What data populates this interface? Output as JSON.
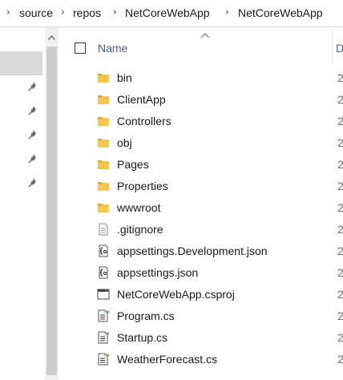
{
  "breadcrumb": {
    "parts": [
      "source",
      "repos",
      "NetCoreWebApp",
      "NetCoreWebApp"
    ],
    "separator": "›"
  },
  "header": {
    "name_label": "Name",
    "next_column_fragment": "D"
  },
  "files": [
    {
      "name": "bin",
      "type": "folder",
      "date_fragment": "2"
    },
    {
      "name": "ClientApp",
      "type": "folder",
      "date_fragment": "2"
    },
    {
      "name": "Controllers",
      "type": "folder",
      "date_fragment": "2"
    },
    {
      "name": "obj",
      "type": "folder",
      "date_fragment": "2"
    },
    {
      "name": "Pages",
      "type": "folder",
      "date_fragment": "2"
    },
    {
      "name": "Properties",
      "type": "folder",
      "date_fragment": "2"
    },
    {
      "name": "wwwroot",
      "type": "folder",
      "date_fragment": "2"
    },
    {
      "name": ".gitignore",
      "type": "text-file",
      "date_fragment": "2"
    },
    {
      "name": "appsettings.Development.json",
      "type": "json-file",
      "date_fragment": "2"
    },
    {
      "name": "appsettings.json",
      "type": "json-file",
      "date_fragment": "2"
    },
    {
      "name": "NetCoreWebApp.csproj",
      "type": "csproj-file",
      "date_fragment": "2"
    },
    {
      "name": "Program.cs",
      "type": "cs-file",
      "date_fragment": "2"
    },
    {
      "name": "Startup.cs",
      "type": "cs-file",
      "date_fragment": "2"
    },
    {
      "name": "WeatherForecast.cs",
      "type": "cs-file",
      "date_fragment": "2"
    }
  ],
  "icons": {
    "folder": "folder-icon",
    "text-file": "text-file-icon",
    "json-file": "json-file-icon",
    "csproj-file": "csproj-file-icon",
    "cs-file": "cs-file-icon",
    "pin": "pin-icon",
    "chevron": "chevron-right-icon",
    "scroll-up": "scroll-up-arrow-icon",
    "sort": "sort-ascending-icon"
  },
  "colors": {
    "folder": "#f0c34a",
    "header_text": "#4c607a",
    "selection": "#d9d9d9",
    "scrollbar_track": "#f0f0f0",
    "scrollbar_thumb": "#cdcdcd"
  }
}
